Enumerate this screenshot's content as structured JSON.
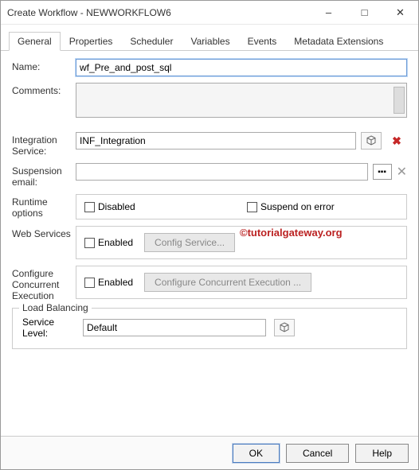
{
  "window": {
    "title": "Create Workflow - NEWWORKFLOW6"
  },
  "tabs": {
    "general": "General",
    "properties": "Properties",
    "scheduler": "Scheduler",
    "variables": "Variables",
    "events": "Events",
    "metadata": "Metadata Extensions"
  },
  "form": {
    "name_label": "Name:",
    "name_value": "wf_Pre_and_post_sql",
    "comments_label": "Comments:",
    "integration_label": "Integration Service:",
    "integration_value": "INF_Integration",
    "suspension_label": "Suspension email:",
    "runtime_label": "Runtime options",
    "disabled_label": "Disabled",
    "suspend_error_label": "Suspend on error",
    "web_services_label": "Web Services",
    "enabled_label": "Enabled",
    "config_service_btn": "Config Service...",
    "cce_label": "Configure Concurrent Execution",
    "cce_btn": "Configure Concurrent Execution ...",
    "load_balancing_legend": "Load Balancing",
    "service_level_label": "Service Level:",
    "service_level_value": "Default"
  },
  "watermark": "©tutorialgateway.org",
  "buttons": {
    "ok": "OK",
    "cancel": "Cancel",
    "help": "Help"
  }
}
